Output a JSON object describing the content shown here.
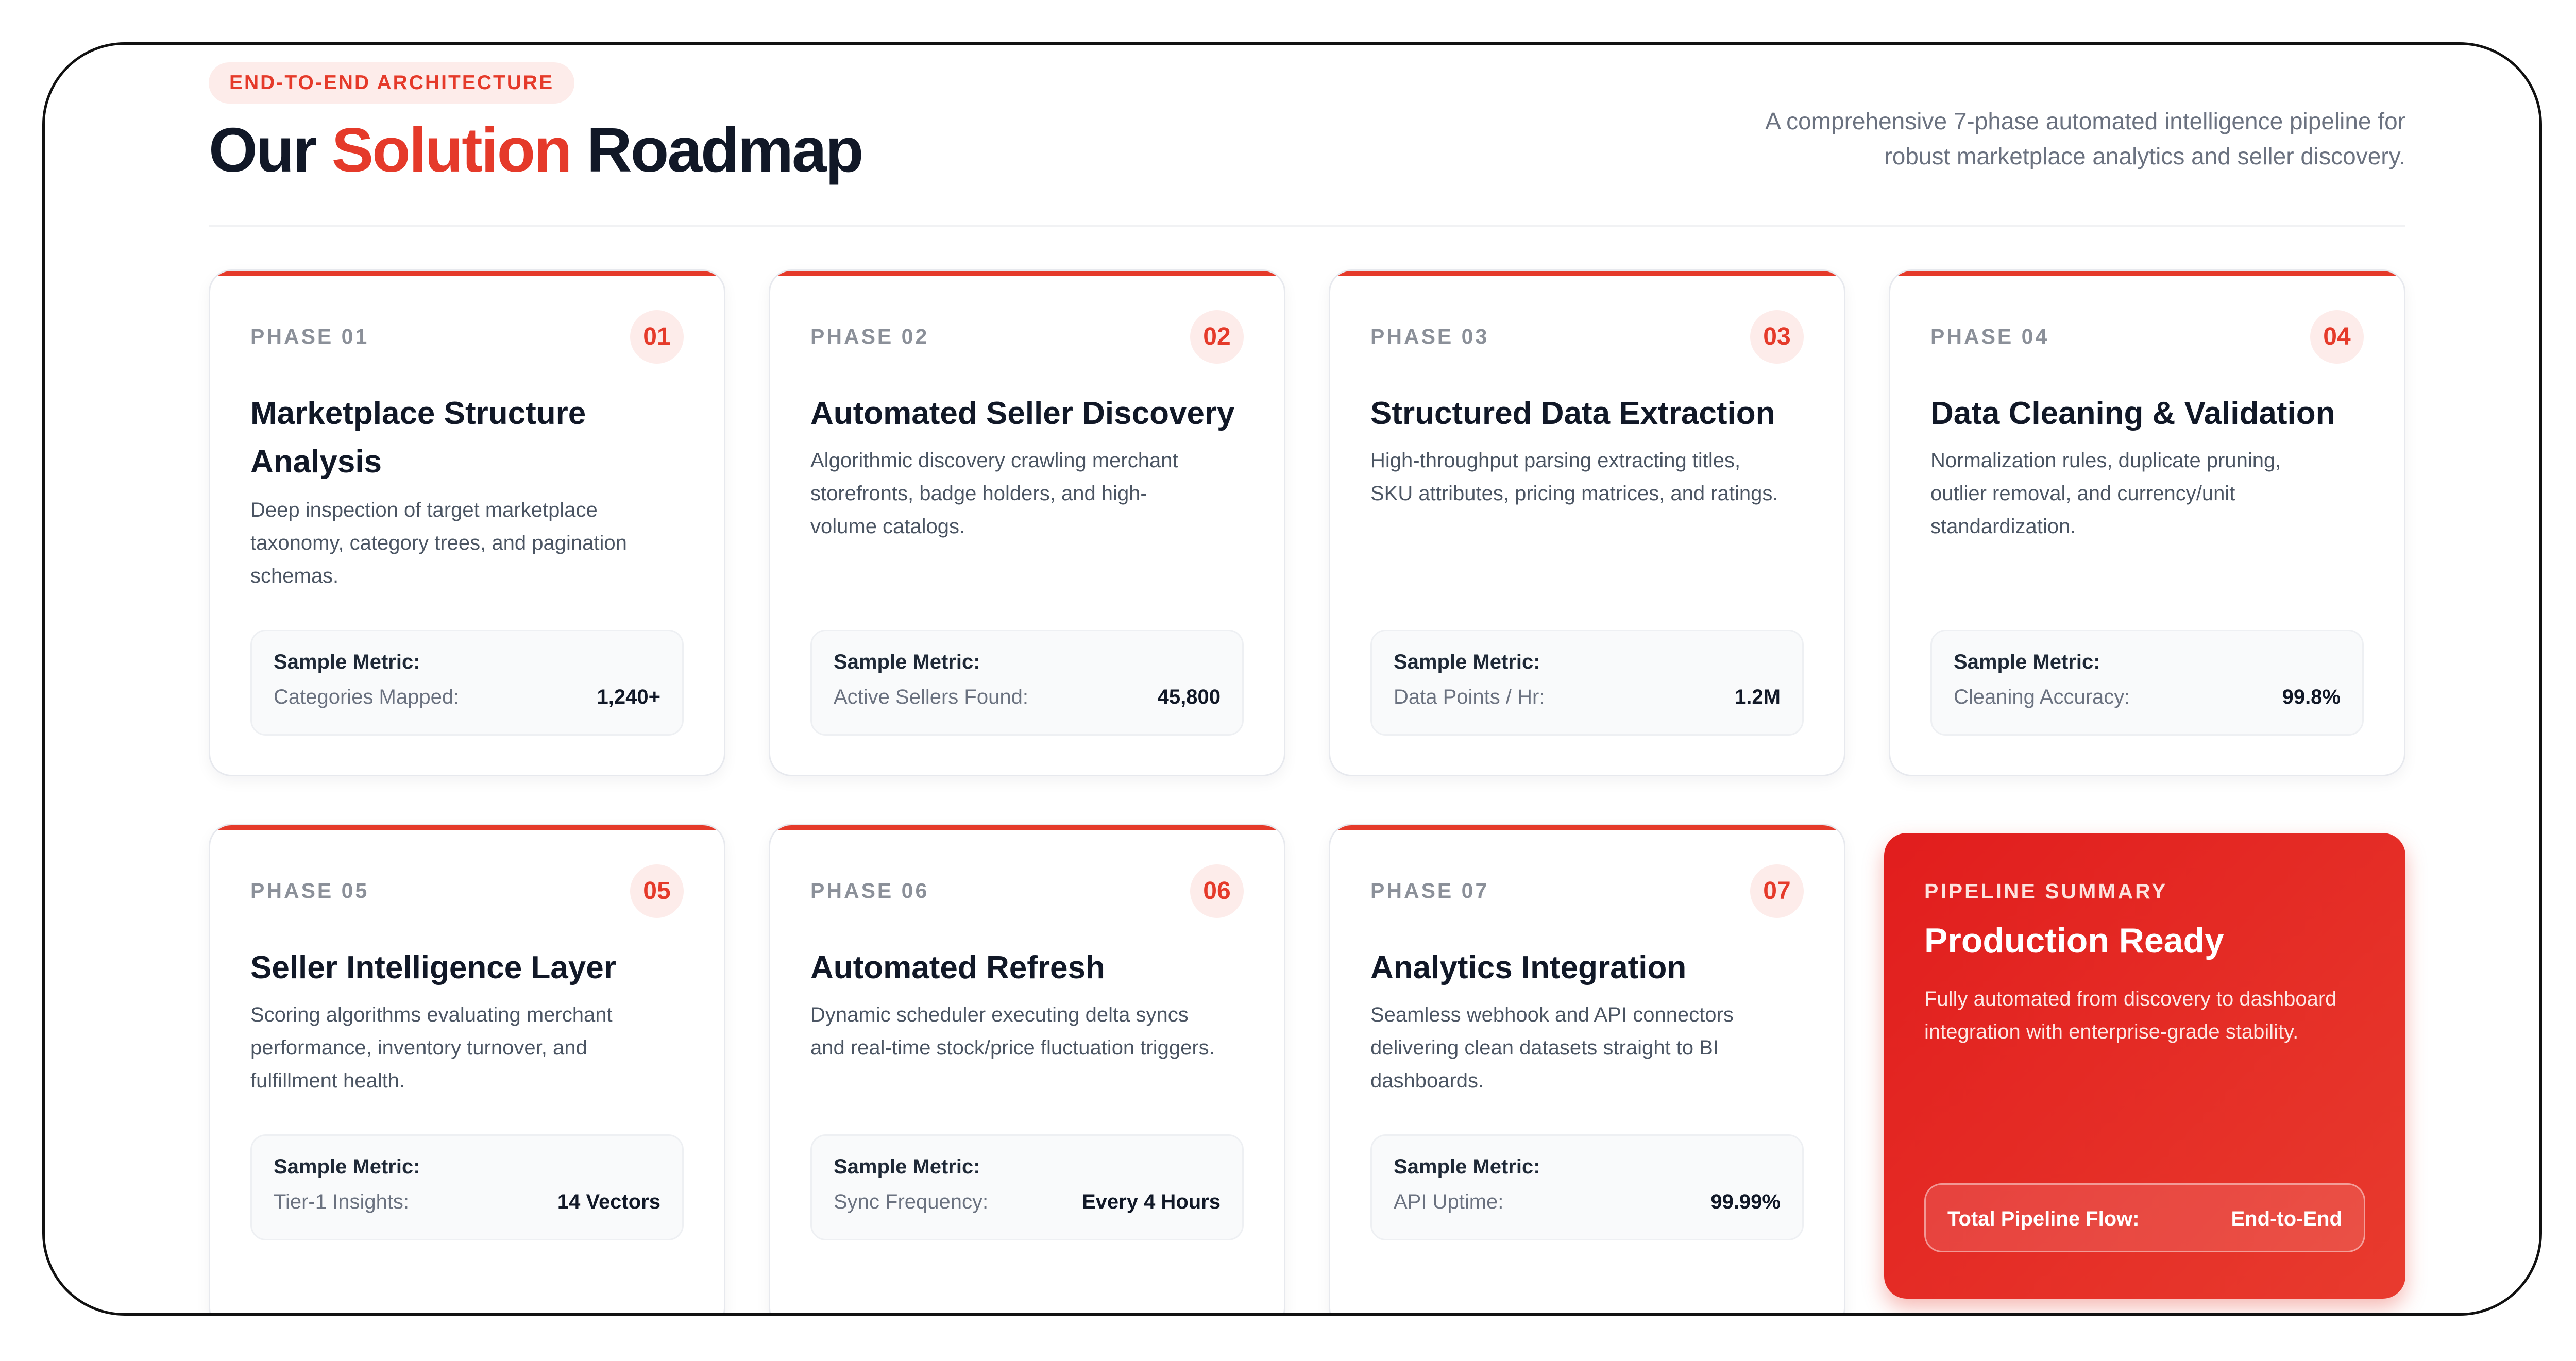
{
  "header": {
    "eyebrow": "END-TO-END ARCHITECTURE",
    "title_before": "Our ",
    "title_accent": "Solution",
    "title_after": " Roadmap",
    "subtitle_line1": "A comprehensive 7-phase automated intelligence pipeline for",
    "subtitle_line2": "robust marketplace analytics and seller discovery."
  },
  "colors": {
    "accent": "#e53a2a",
    "summary_bg": "#e11d1d",
    "text": "#111827",
    "muted": "#6b7280"
  },
  "phases": [
    {
      "label": "PHASE 01",
      "num": "01",
      "title": "Marketplace Structure Analysis",
      "desc": "Deep inspection of target marketplace taxonomy, category trees, and pagination schemas.",
      "metric_head": "Sample Metric:",
      "metric_label": "Categories Mapped:",
      "metric_value": "1,240+"
    },
    {
      "label": "PHASE 02",
      "num": "02",
      "title": "Automated Seller Discovery",
      "desc": "Algorithmic discovery crawling merchant storefronts, badge holders, and high-volume catalogs.",
      "metric_head": "Sample Metric:",
      "metric_label": "Active Sellers Found:",
      "metric_value": "45,800"
    },
    {
      "label": "PHASE 03",
      "num": "03",
      "title": "Structured Data Extraction",
      "desc": "High-throughput parsing extracting titles, SKU attributes, pricing matrices, and ratings.",
      "metric_head": "Sample Metric:",
      "metric_label": "Data Points / Hr:",
      "metric_value": "1.2M"
    },
    {
      "label": "PHASE 04",
      "num": "04",
      "title": "Data Cleaning & Validation",
      "desc": "Normalization rules, duplicate pruning, outlier removal, and currency/unit standardization.",
      "metric_head": "Sample Metric:",
      "metric_label": "Cleaning Accuracy:",
      "metric_value": "99.8%"
    },
    {
      "label": "PHASE 05",
      "num": "05",
      "title": "Seller Intelligence Layer",
      "desc": "Scoring algorithms evaluating merchant performance, inventory turnover, and fulfillment health.",
      "metric_head": "Sample Metric:",
      "metric_label": "Tier-1 Insights:",
      "metric_value": "14 Vectors"
    },
    {
      "label": "PHASE 06",
      "num": "06",
      "title": "Automated Refresh",
      "desc": "Dynamic scheduler executing delta syncs and real-time stock/price fluctuation triggers.",
      "metric_head": "Sample Metric:",
      "metric_label": "Sync Frequency:",
      "metric_value": "Every 4 Hours"
    },
    {
      "label": "PHASE 07",
      "num": "07",
      "title": "Analytics Integration",
      "desc": "Seamless webhook and API connectors delivering clean datasets straight to BI dashboards.",
      "metric_head": "Sample Metric:",
      "metric_label": "API Uptime:",
      "metric_value": "99.99%"
    }
  ],
  "summary": {
    "eyebrow": "PIPELINE SUMMARY",
    "title": "Production Ready",
    "desc": "Fully automated from discovery to dashboard integration with enterprise-grade stability.",
    "flow_label": "Total Pipeline Flow:",
    "flow_value": "End-to-End"
  }
}
